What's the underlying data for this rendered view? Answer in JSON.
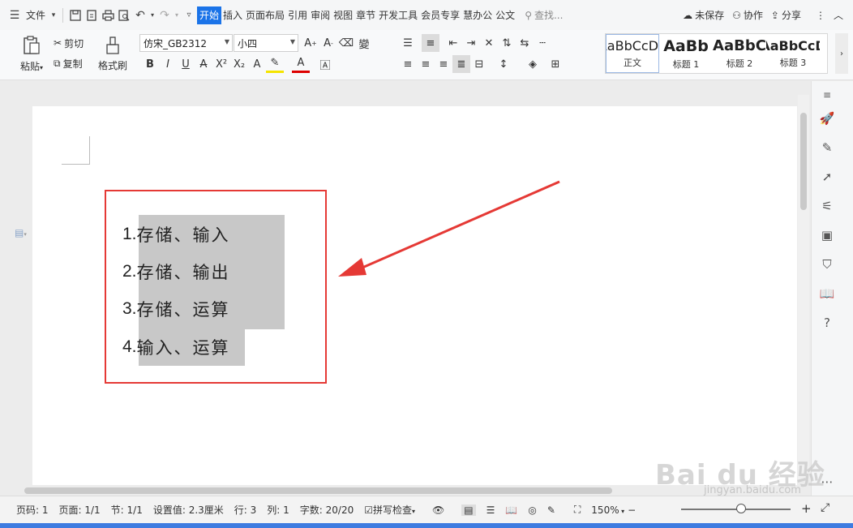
{
  "menubar": {
    "file_label": "文件",
    "tabs": [
      "开始",
      "插入",
      "页面布局",
      "引用",
      "审阅",
      "视图",
      "章节",
      "开发工具",
      "会员专享",
      "慧办公",
      "公文"
    ],
    "active_tab": "开始",
    "search_placeholder": "查找...",
    "unsaved_label": "未保存",
    "collab_label": "协作",
    "share_label": "分享"
  },
  "ribbon": {
    "paste_label": "粘贴",
    "cut_label": "剪切",
    "copy_label": "复制",
    "format_painter_label": "格式刷",
    "font_name": "仿宋_GB2312",
    "font_size": "小四",
    "styles": [
      {
        "sample": "AaBbCcDd",
        "name": "正文"
      },
      {
        "sample": "AaBb",
        "name": "标题 1"
      },
      {
        "sample": "AaBbC",
        "name": "标题 2"
      },
      {
        "sample": "AaBbCcD",
        "name": "标题 3"
      }
    ]
  },
  "document": {
    "list_items": [
      {
        "num": "1.",
        "text": "存储、输入"
      },
      {
        "num": "2.",
        "text": "存储、输出"
      },
      {
        "num": "3.",
        "text": "存储、运算"
      },
      {
        "num": "4.",
        "text": "输入、运算"
      }
    ],
    "annotation_color": "#e53935",
    "highlight_color": "#c8c8c8"
  },
  "status": {
    "page_num": "页码: 1",
    "pages": "页面: 1/1",
    "section": "节: 1/1",
    "setting": "设置值: 2.3厘米",
    "row": "行: 3",
    "col": "列: 1",
    "word_count": "字数: 20/20",
    "spell_check": "拼写检查",
    "zoom": "150%"
  },
  "watermark": {
    "brand": "Bai du 经验",
    "url": "jingyan.baidu.com"
  },
  "colors": {
    "accent": "#1a73e8",
    "taskbar": "#3d7be0"
  }
}
